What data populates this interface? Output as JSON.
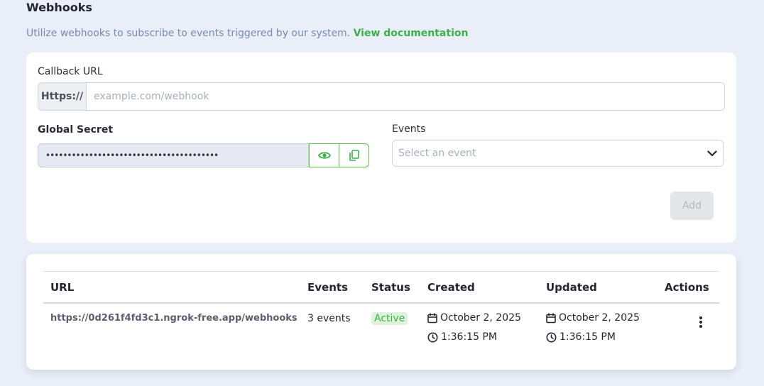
{
  "header": {
    "title": "Webhooks",
    "subtitle": "Utilize webhooks to subscribe to events triggered by our system. ",
    "doc_link": "View documentation"
  },
  "form": {
    "callback_label": "Callback URL",
    "url_prefix": "Https://",
    "url_placeholder": "example.com/webhook",
    "secret_label": "Global Secret",
    "secret_value": "••••••••••••••••••••••••••••••••••••••••",
    "events_label": "Events",
    "events_placeholder": "Select an event",
    "add_button": "Add"
  },
  "table": {
    "columns": [
      "URL",
      "Events",
      "Status",
      "Created",
      "Updated",
      "Actions"
    ],
    "rows": [
      {
        "url": "https://0d261f4fd3c1.ngrok-free.app/webhooks",
        "events": "3 events",
        "status": "Active",
        "created_date": "October 2, 2025",
        "created_time": "1:36:15 PM",
        "updated_date": "October 2, 2025",
        "updated_time": "1:36:15 PM"
      }
    ]
  },
  "colors": {
    "accent_green": "#3cae4a",
    "background": "#eaeef8",
    "subtitle": "#7a89b3"
  },
  "icons": [
    "eye-icon",
    "copy-icon",
    "chevron-down-icon",
    "calendar-icon",
    "clock-icon",
    "more-vertical-icon"
  ]
}
